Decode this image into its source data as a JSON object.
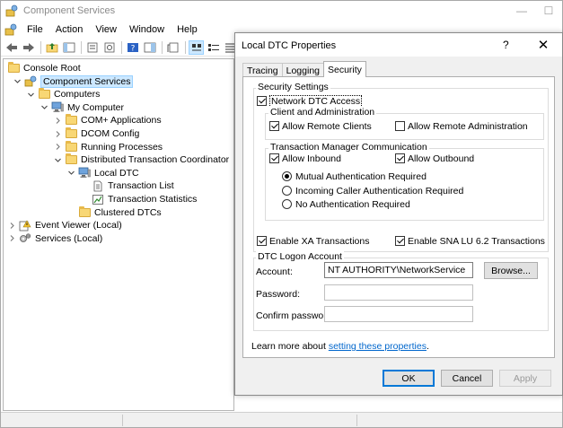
{
  "window": {
    "title": "Component Services",
    "controls": {
      "minimize": "—",
      "maximize": "☐",
      "close": "✕"
    }
  },
  "menu": [
    "File",
    "Action",
    "View",
    "Window",
    "Help"
  ],
  "tree": [
    {
      "label": "Console Root",
      "level": 0,
      "icon": "folder-icon",
      "expander": ""
    },
    {
      "label": "Component Services",
      "level": 1,
      "icon": "component-services-icon",
      "expander": "expanded",
      "selected": true
    },
    {
      "label": "Computers",
      "level": 2,
      "icon": "folder-icon",
      "expander": "expanded"
    },
    {
      "label": "My Computer",
      "level": 3,
      "icon": "computer-icon",
      "expander": "expanded"
    },
    {
      "label": "COM+ Applications",
      "level": 4,
      "icon": "folder-icon",
      "expander": "collapsed"
    },
    {
      "label": "DCOM Config",
      "level": 4,
      "icon": "folder-icon",
      "expander": "collapsed"
    },
    {
      "label": "Running Processes",
      "level": 4,
      "icon": "folder-icon",
      "expander": "collapsed"
    },
    {
      "label": "Distributed Transaction Coordinator",
      "level": 4,
      "icon": "folder-icon",
      "expander": "expanded"
    },
    {
      "label": "Local DTC",
      "level": 5,
      "icon": "computer-icon",
      "expander": "expanded"
    },
    {
      "label": "Transaction List",
      "level": 6,
      "icon": "document-icon",
      "expander": ""
    },
    {
      "label": "Transaction Statistics",
      "level": 6,
      "icon": "statistics-icon",
      "expander": ""
    },
    {
      "label": "Clustered DTCs",
      "level": 5,
      "icon": "folder-icon",
      "expander": ""
    },
    {
      "label": "Event Viewer (Local)",
      "level": 0,
      "icon": "event-viewer-icon",
      "expander": "collapsed"
    },
    {
      "label": "Services (Local)",
      "level": 0,
      "icon": "services-icon",
      "expander": "collapsed"
    }
  ],
  "dialog": {
    "title": "Local DTC Properties",
    "help": "?",
    "close": "✕",
    "tabs": [
      {
        "label": "Tracing",
        "active": false
      },
      {
        "label": "Logging",
        "active": false
      },
      {
        "label": "Security",
        "active": true
      }
    ],
    "security_settings": {
      "title": "Security Settings",
      "network_dtc_access": {
        "label": "Network DTC Access",
        "checked": true
      },
      "client_admin": {
        "title": "Client and Administration",
        "allow_remote_clients": {
          "label": "Allow Remote Clients",
          "checked": true
        },
        "allow_remote_admin": {
          "label": "Allow Remote Administration",
          "checked": false
        }
      },
      "tm_comm": {
        "title": "Transaction Manager Communication",
        "allow_inbound": {
          "label": "Allow Inbound",
          "checked": true
        },
        "allow_outbound": {
          "label": "Allow Outbound",
          "checked": true
        },
        "radios": [
          {
            "label": "Mutual Authentication Required",
            "selected": true
          },
          {
            "label": "Incoming Caller Authentication Required",
            "selected": false
          },
          {
            "label": "No Authentication Required",
            "selected": false
          }
        ]
      },
      "enable_xa": {
        "label": "Enable XA Transactions",
        "checked": true
      },
      "enable_sna": {
        "label": "Enable SNA LU 6.2 Transactions",
        "checked": true
      }
    },
    "logon": {
      "title": "DTC Logon Account",
      "account_label": "Account:",
      "account_value": "NT AUTHORITY\\NetworkService",
      "browse": "Browse...",
      "password_label": "Password:",
      "password_value": "",
      "confirm_label": "Confirm password:",
      "confirm_value": ""
    },
    "learn_more": {
      "prefix": "Learn more about ",
      "link": "setting these properties",
      "suffix": "."
    },
    "buttons": {
      "ok": "OK",
      "cancel": "Cancel",
      "apply": "Apply"
    }
  },
  "colors": {
    "selection": "#cce8ff",
    "link": "#0066cc",
    "default_button_border": "#0078d7"
  }
}
